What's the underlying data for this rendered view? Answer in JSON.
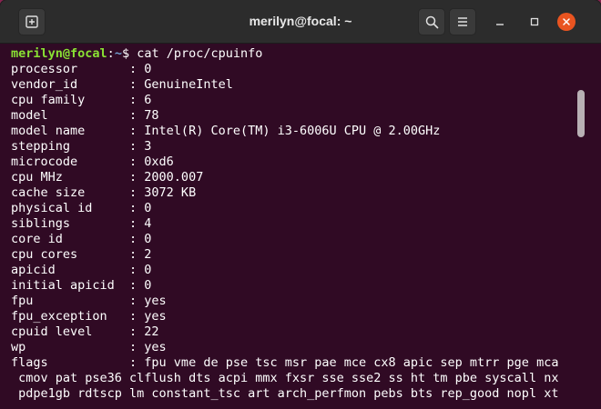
{
  "window": {
    "title": "merilyn@focal: ~"
  },
  "icons": {
    "new_tab": "new-tab-icon",
    "search": "search-icon",
    "menu": "hamburger-menu-icon",
    "minimize": "minimize-icon",
    "maximize": "maximize-icon",
    "close": "close-icon"
  },
  "colors": {
    "terminal_bg": "#300a24",
    "prompt_user": "#8ae234",
    "prompt_path": "#729fcf",
    "close_button": "#e95420"
  },
  "prompt": {
    "user_host": "merilyn@focal",
    "separator": ":",
    "path": "~",
    "symbol": "$",
    "command": " cat /proc/cpuinfo"
  },
  "output": [
    "processor       : 0",
    "vendor_id       : GenuineIntel",
    "cpu family      : 6",
    "model           : 78",
    "model name      : Intel(R) Core(TM) i3-6006U CPU @ 2.00GHz",
    "stepping        : 3",
    "microcode       : 0xd6",
    "cpu MHz         : 2000.007",
    "cache size      : 3072 KB",
    "physical id     : 0",
    "siblings        : 4",
    "core id         : 0",
    "cpu cores       : 2",
    "apicid          : 0",
    "initial apicid  : 0",
    "fpu             : yes",
    "fpu_exception   : yes",
    "cpuid level     : 22",
    "wp              : yes",
    "flags           : fpu vme de pse tsc msr pae mce cx8 apic sep mtrr pge mca",
    " cmov pat pse36 clflush dts acpi mmx fxsr sse sse2 ss ht tm pbe syscall nx",
    " pdpe1gb rdtscp lm constant_tsc art arch_perfmon pebs bts rep_good nopl xt"
  ]
}
